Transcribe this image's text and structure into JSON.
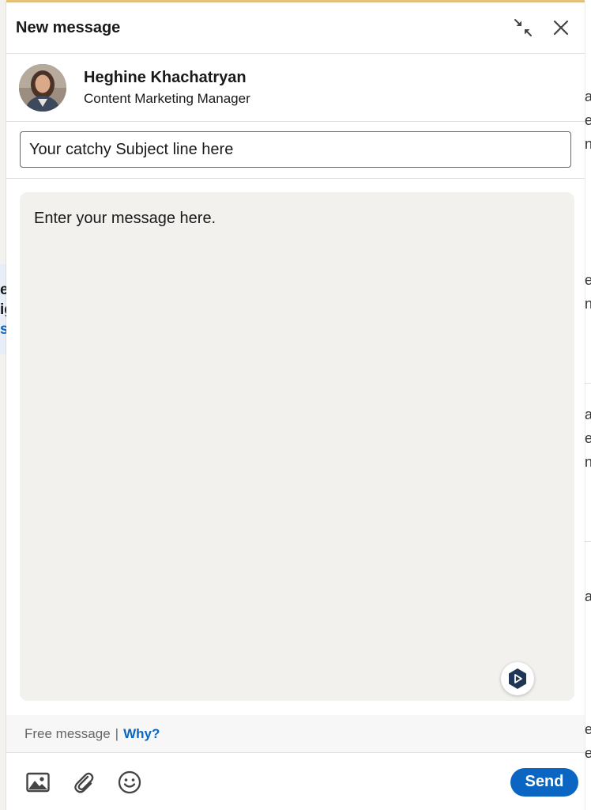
{
  "dialog": {
    "title": "New message"
  },
  "recipient": {
    "name": "Heghine Khachatryan",
    "headline": "Content Marketing Manager"
  },
  "subject": {
    "placeholder": "Your catchy Subject line here"
  },
  "message": {
    "placeholder": "Enter your message here."
  },
  "footer": {
    "free_message": "Free message",
    "separator": "|",
    "why_link": "Why?"
  },
  "toolbar": {
    "icons": [
      "image-icon",
      "paperclip-icon",
      "emoji-icon"
    ],
    "send_label": "Send"
  },
  "background": {
    "left_fragments": [
      "e",
      "ig",
      "s"
    ],
    "right_fragments": [
      "a",
      "e",
      "n",
      "e",
      "n",
      "a",
      "e",
      "n",
      "a",
      "e",
      "e"
    ]
  },
  "colors": {
    "accent": "#0a66c2",
    "message_bg": "#f2f1ee",
    "top_accent": "#e7c47a"
  }
}
